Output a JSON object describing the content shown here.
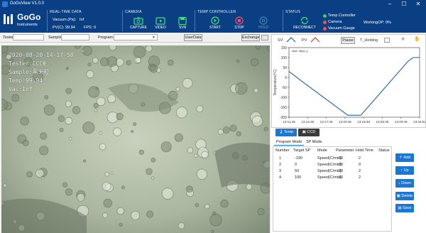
{
  "window": {
    "title": "GoGoView V1.0.0",
    "minimize": "–",
    "maximize": "☐",
    "close": "✕"
  },
  "logo": {
    "line1": "GoGo",
    "line2": "Instruments"
  },
  "realtime": {
    "section": "REAL-TIME DATA",
    "vacuum_label": "Vacuum (Pa):",
    "vacuum_value": "Inf",
    "pv_label": "PV(C):",
    "pv_value": "99.94",
    "fps_label": "FPS:",
    "fps_value": "0"
  },
  "camera": {
    "section": "CAMERA",
    "capture": "CAPTURE",
    "video": "VIDEO",
    "svn": "SVN"
  },
  "temp": {
    "section": "TEMP CONTROLLER",
    "start": "START",
    "stop": "STOP",
    "hold": "HOLD"
  },
  "status": {
    "section": "STATUS",
    "reconnect": "RECONNECT",
    "items": [
      {
        "label": "Temp Controller",
        "color": "#3ad35a"
      },
      {
        "label": "Camera",
        "color": "#ff4d4d"
      },
      {
        "label": "Vacuum Gauge",
        "color": "#ff4d4d"
      }
    ],
    "working_label": "WorkingOP:",
    "working_value": "0%"
  },
  "toolbar": {
    "tester_label": "Tester",
    "sample_label": "Sample",
    "program_label": "Program",
    "userdata": "UserData",
    "exchange": "Exchange"
  },
  "overlay": {
    "lines": [
      "2020-08-20-14-17-58",
      "Tester:CCCC",
      "Sample:黑米粒",
      "Temp:99.94",
      "Vac:Inf"
    ]
  },
  "chartbar": {
    "sv_label": "SV:",
    "pv_label": "PV:",
    "pause": "Pause",
    "holding": "T_Holding",
    "plus": "+",
    "hand": "✋"
  },
  "chart_data": {
    "type": "line",
    "title": "",
    "ylabel": "Temperature(°C)",
    "ylim": [
      -200,
      150
    ],
    "yticks": [
      -200,
      -150,
      -100,
      -50,
      0,
      50,
      100,
      150
    ],
    "xticks": [
      "13:11:46",
      "13:14:46",
      "13:17:46",
      "13:20:46",
      "13:23:46",
      "13:26:46",
      "13:29:46",
      "13:34:52"
    ],
    "legend": "NNA-1",
    "series": [
      {
        "name": "NNA-1",
        "color": "#1f5fa8",
        "x": [
          0,
          0.1,
          0.45,
          0.55,
          0.91,
          0.93,
          0.95,
          0.97,
          1.0
        ],
        "y": [
          30,
          -20,
          -190,
          -190,
          80,
          90,
          100,
          100,
          100
        ]
      }
    ]
  },
  "panel": {
    "tab_temp": "Temp",
    "tab_ccd": "CCD",
    "subtab_program": "Program Mode",
    "subtab_sp": "SP Mode",
    "columns": [
      "Number",
      "Target SP",
      "Mode",
      "Parameter",
      "Hold Time",
      "Status"
    ],
    "rows": [
      [
        "1",
        "-190",
        "Speed(C/min)",
        "30",
        "2",
        ""
      ],
      [
        "2",
        "0",
        "Speed(C/min)",
        "30",
        "0",
        ""
      ],
      [
        "3",
        "50",
        "Speed(C/min)",
        "30",
        "2",
        ""
      ],
      [
        "4",
        "100",
        "Speed(C/min)",
        "30",
        "2",
        ""
      ]
    ],
    "buttons": {
      "add": "Add",
      "up": "Up",
      "down": "Down",
      "delete": "Delete",
      "save": "Save"
    }
  }
}
